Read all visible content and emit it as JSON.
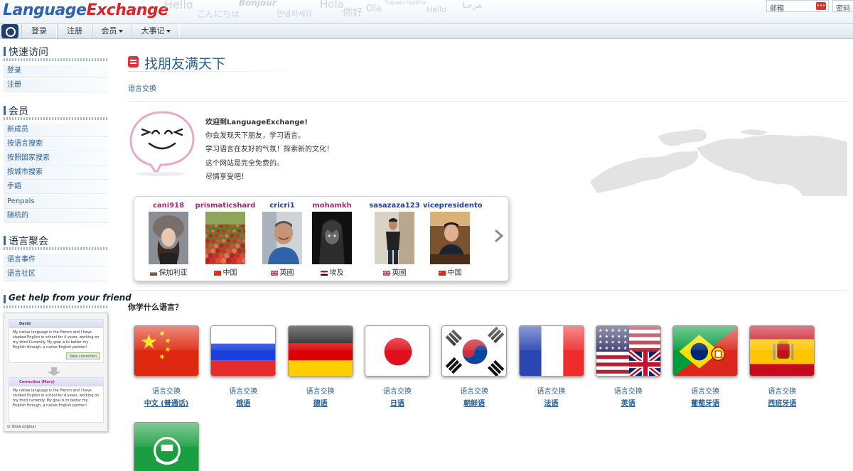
{
  "header": {
    "logo_part1": "Language",
    "logo_part2": "Exchange",
    "greetings": [
      "Hello",
      "こんにちは",
      "Bonjour",
      "안녕하세요",
      "Hola",
      "你好",
      "Ola",
      "Здравствуйте",
      "Hallo",
      "مرحبا"
    ],
    "email_placeholder": "邮箱",
    "password_placeholder": "密码"
  },
  "nav": {
    "items": [
      {
        "label": "登录",
        "dropdown": false
      },
      {
        "label": "注册",
        "dropdown": false
      },
      {
        "label": "会员",
        "dropdown": true
      },
      {
        "label": "大事记",
        "dropdown": true
      }
    ]
  },
  "sidebar": {
    "sections": [
      {
        "title": "快速访问",
        "items": [
          "登录",
          "注册"
        ]
      },
      {
        "title": "会员",
        "items": [
          "新成员",
          "按语言搜索",
          "按照国家搜索",
          "按城市搜索",
          "手語",
          "Penpals",
          "随机的"
        ]
      },
      {
        "title": "语言聚会",
        "items": [
          "语言事件",
          "语言社区"
        ]
      }
    ],
    "help": {
      "title": "Get help from your friend",
      "card1_name": "David",
      "card1_text": "My native language is the French and I have studied English in school for 4 years, working on my third Currently. My goal is to better my English through, a native English partner!",
      "card1_button": "New correction",
      "card2_name": "Correction (Mary)",
      "card2_text": "My native language is the French and I have studied English in school for 4 years, working on my third currently. My goal is to better my English through, a native English partner!",
      "card2_check": "Show original"
    }
  },
  "main": {
    "title": "找朋友满天下",
    "breadcrumb": "语言交换",
    "welcome": [
      "欢迎到LanguageExchange!",
      "你会发现天下朋友，学习语言。",
      "学习语言在友好的气氛！探索新的文化！",
      "这个网站是完全免费的。",
      "尽情享受吧！"
    ],
    "languages_title": "你学什么语言？"
  },
  "members": [
    {
      "name": "cani918",
      "country": "保加利亚",
      "name_color": "#b0227a",
      "flag": "bulgaria",
      "photo": "woman-fur-hat"
    },
    {
      "name": "prismaticshard",
      "country": "中国",
      "name_color": "#b0227a",
      "flag": "china",
      "photo": "tulip-field"
    },
    {
      "name": "cricri1",
      "country": "英國",
      "name_color": "#1d3fa8",
      "flag": "uk",
      "photo": "man-smiling"
    },
    {
      "name": "mohamkh",
      "country": "埃及",
      "name_color": "#b0227a",
      "flag": "egypt",
      "photo": "anime-figure"
    },
    {
      "name": "sasazaza123",
      "country": "英國",
      "name_color": "#1d3fa8",
      "flag": "uk",
      "photo": "man-standing"
    },
    {
      "name": "vicepresidento",
      "country": "中国",
      "name_color": "#1d3fa8",
      "flag": "china",
      "photo": "man-at-desk"
    }
  ],
  "languages": [
    {
      "sub": "语言交换",
      "name": "中文 (普通话)",
      "flag": "china"
    },
    {
      "sub": "语言交换",
      "name": "俄语",
      "flag": "russia"
    },
    {
      "sub": "语言交换",
      "name": "德语",
      "flag": "germany"
    },
    {
      "sub": "语言交换",
      "name": "日语",
      "flag": "japan"
    },
    {
      "sub": "语言交换",
      "name": "朝鲜语",
      "flag": "korea"
    },
    {
      "sub": "语言交换",
      "name": "法语",
      "flag": "france"
    },
    {
      "sub": "语言交换",
      "name": "英语",
      "flag": "us-uk"
    },
    {
      "sub": "语言交换",
      "name": "葡萄牙语",
      "flag": "portugal-brazil"
    },
    {
      "sub": "语言交换",
      "name": "西班牙语",
      "flag": "spain"
    },
    {
      "sub": "",
      "name": "",
      "flag": "arabic"
    }
  ]
}
